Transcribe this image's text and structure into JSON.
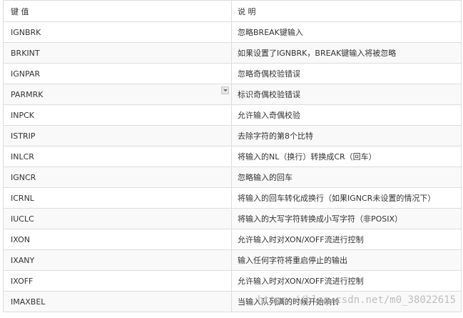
{
  "table": {
    "header": {
      "key": "键 值",
      "desc": "说 明"
    },
    "rows": [
      {
        "key": "IGNBRK",
        "desc": "忽略BREAK键输入"
      },
      {
        "key": "BRKINT",
        "desc": "如果设置了IGNBRK，BREAK键输入将被忽略"
      },
      {
        "key": "IGNPAR",
        "desc": "忽略奇偶校验错误"
      },
      {
        "key": "PARMRK",
        "desc": "标识奇偶校验错误"
      },
      {
        "key": "INPCK",
        "desc": "允许输入奇偶校验"
      },
      {
        "key": "ISTRIP",
        "desc": "去除字符的第8个比特"
      },
      {
        "key": "INLCR",
        "desc": "将输入的NL（换行）转换成CR（回车）"
      },
      {
        "key": "IGNCR",
        "desc": "忽略输入的回车"
      },
      {
        "key": "ICRNL",
        "desc": "将输入的回车转化成换行（如果IGNCR未设置的情况下）"
      },
      {
        "key": "IUCLC",
        "desc": "将输入的大写字符转换成小写字符（非POSIX）"
      },
      {
        "key": "IXON",
        "desc": "允许输入时对XON/XOFF流进行控制"
      },
      {
        "key": "IXANY",
        "desc": "输入任何字符将重启停止的输出"
      },
      {
        "key": "IXOFF",
        "desc": "允许输入时对XON/XOFF流进行控制"
      },
      {
        "key": "IMAXBEL",
        "desc": "当输入队列满的时候开始响铃"
      }
    ]
  },
  "watermark": "https://blog.csdn.net/m0_38022615",
  "colors": {
    "border": "#dddddd",
    "alt_row": "#f9f9f9",
    "text": "#333333"
  }
}
